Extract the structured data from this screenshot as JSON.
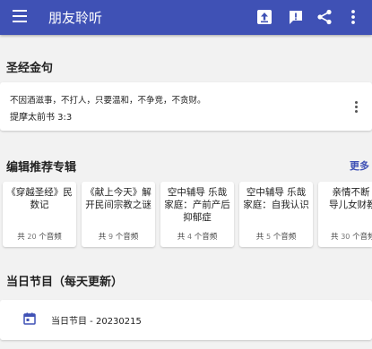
{
  "app": {
    "title": "朋友聆听",
    "icons": [
      "menu-icon",
      "upload-icon",
      "feedback-icon",
      "share-icon",
      "more-vert-icon"
    ],
    "colors": {
      "primary": "#3f51b5",
      "background": "#f2f2f2",
      "card": "#ffffff"
    }
  },
  "verse": {
    "section_title": "圣经金句",
    "text": "不因酒滋事，不打人，只要温和，不争竞，不贪财。",
    "reference": "提摩太前书 3:3"
  },
  "albums": {
    "section_title": "编辑推荐专辑",
    "more_label": "更多",
    "items": [
      {
        "name": "《穿越圣经》民数记",
        "prefix": "共",
        "count": "20",
        "suffix": "个音频"
      },
      {
        "name": "《献上今天》解开民间宗教之谜",
        "prefix": "共",
        "count": "9",
        "suffix": "个音频"
      },
      {
        "name": "空中辅导 乐哉家庭：产前产后抑郁症",
        "prefix": "共",
        "count": "4",
        "suffix": "个音频"
      },
      {
        "name": "空中辅导 乐哉家庭：自我认识",
        "prefix": "共",
        "count": "5",
        "suffix": "个音频"
      },
      {
        "name": "亲情不断《教导儿女财教育》",
        "prefix": "共",
        "count": "30",
        "suffix": "个音频"
      }
    ]
  },
  "daily": {
    "section_title": "当日节目（每天更新）",
    "program_label": "当日节目 - 20230215"
  }
}
